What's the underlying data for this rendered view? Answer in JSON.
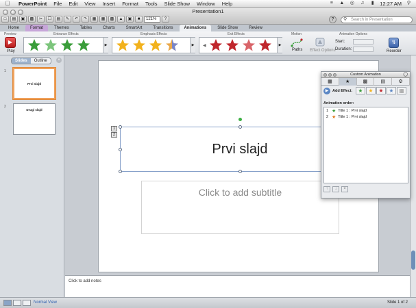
{
  "menubar": {
    "apple": "",
    "app_name": "PowerPoint",
    "items": [
      "File",
      "Edit",
      "View",
      "Insert",
      "Format",
      "Tools",
      "Slide Show",
      "Window",
      "Help"
    ],
    "clock": "12:27 AM"
  },
  "window": {
    "title": "Presentation1",
    "zoom": "121%",
    "search_placeholder": "Search in Presentation"
  },
  "ribbon_tabs": [
    {
      "label": "Home"
    },
    {
      "label": "Format"
    },
    {
      "label": "Themes"
    },
    {
      "label": "Tables"
    },
    {
      "label": "Charts"
    },
    {
      "label": "SmartArt"
    },
    {
      "label": "Transitions"
    },
    {
      "label": "Animations"
    },
    {
      "label": "Slide Show"
    },
    {
      "label": "Review"
    }
  ],
  "ribbon": {
    "preview_label": "Preview",
    "play_label": "Play",
    "entrance_label": "Entrance Effects",
    "emphasis_label": "Emphasis Effects",
    "exit_label": "Exit Effects",
    "motion_label": "Motion",
    "paths_label": "Paths",
    "effect_options_label": "Effect Options",
    "animation_options_label": "Animation Options",
    "start_label": "Start:",
    "duration_label": "Duration:",
    "reorder_label": "Reorder"
  },
  "slide_pane": {
    "tab_slides": "Slides",
    "tab_outline": "Outline",
    "slides": [
      {
        "number": "1",
        "title": "Prvi slajd"
      },
      {
        "number": "2",
        "title": "Drugi slajd"
      }
    ]
  },
  "slide": {
    "title": "Prvi slajd",
    "subtitle_placeholder": "Click to add subtitle",
    "anim_tags": [
      "1",
      "2"
    ]
  },
  "notes": {
    "placeholder": "Click to add notes"
  },
  "status": {
    "view": "Normal View",
    "slide_count": "Slide 1 of 2"
  },
  "custom_animation": {
    "title": "Custom Animation",
    "add_effect_label": "Add Effect:",
    "order_label": "Animation order:",
    "items": [
      {
        "n": "1",
        "text": "Title 1 : Prvi slajd"
      },
      {
        "n": "2",
        "text": "Title 1 : Prvi slajd"
      }
    ]
  },
  "colors": {
    "entrance": "#3a9d3a",
    "emphasis": "#f2b21d",
    "exit": "#c0272d"
  }
}
